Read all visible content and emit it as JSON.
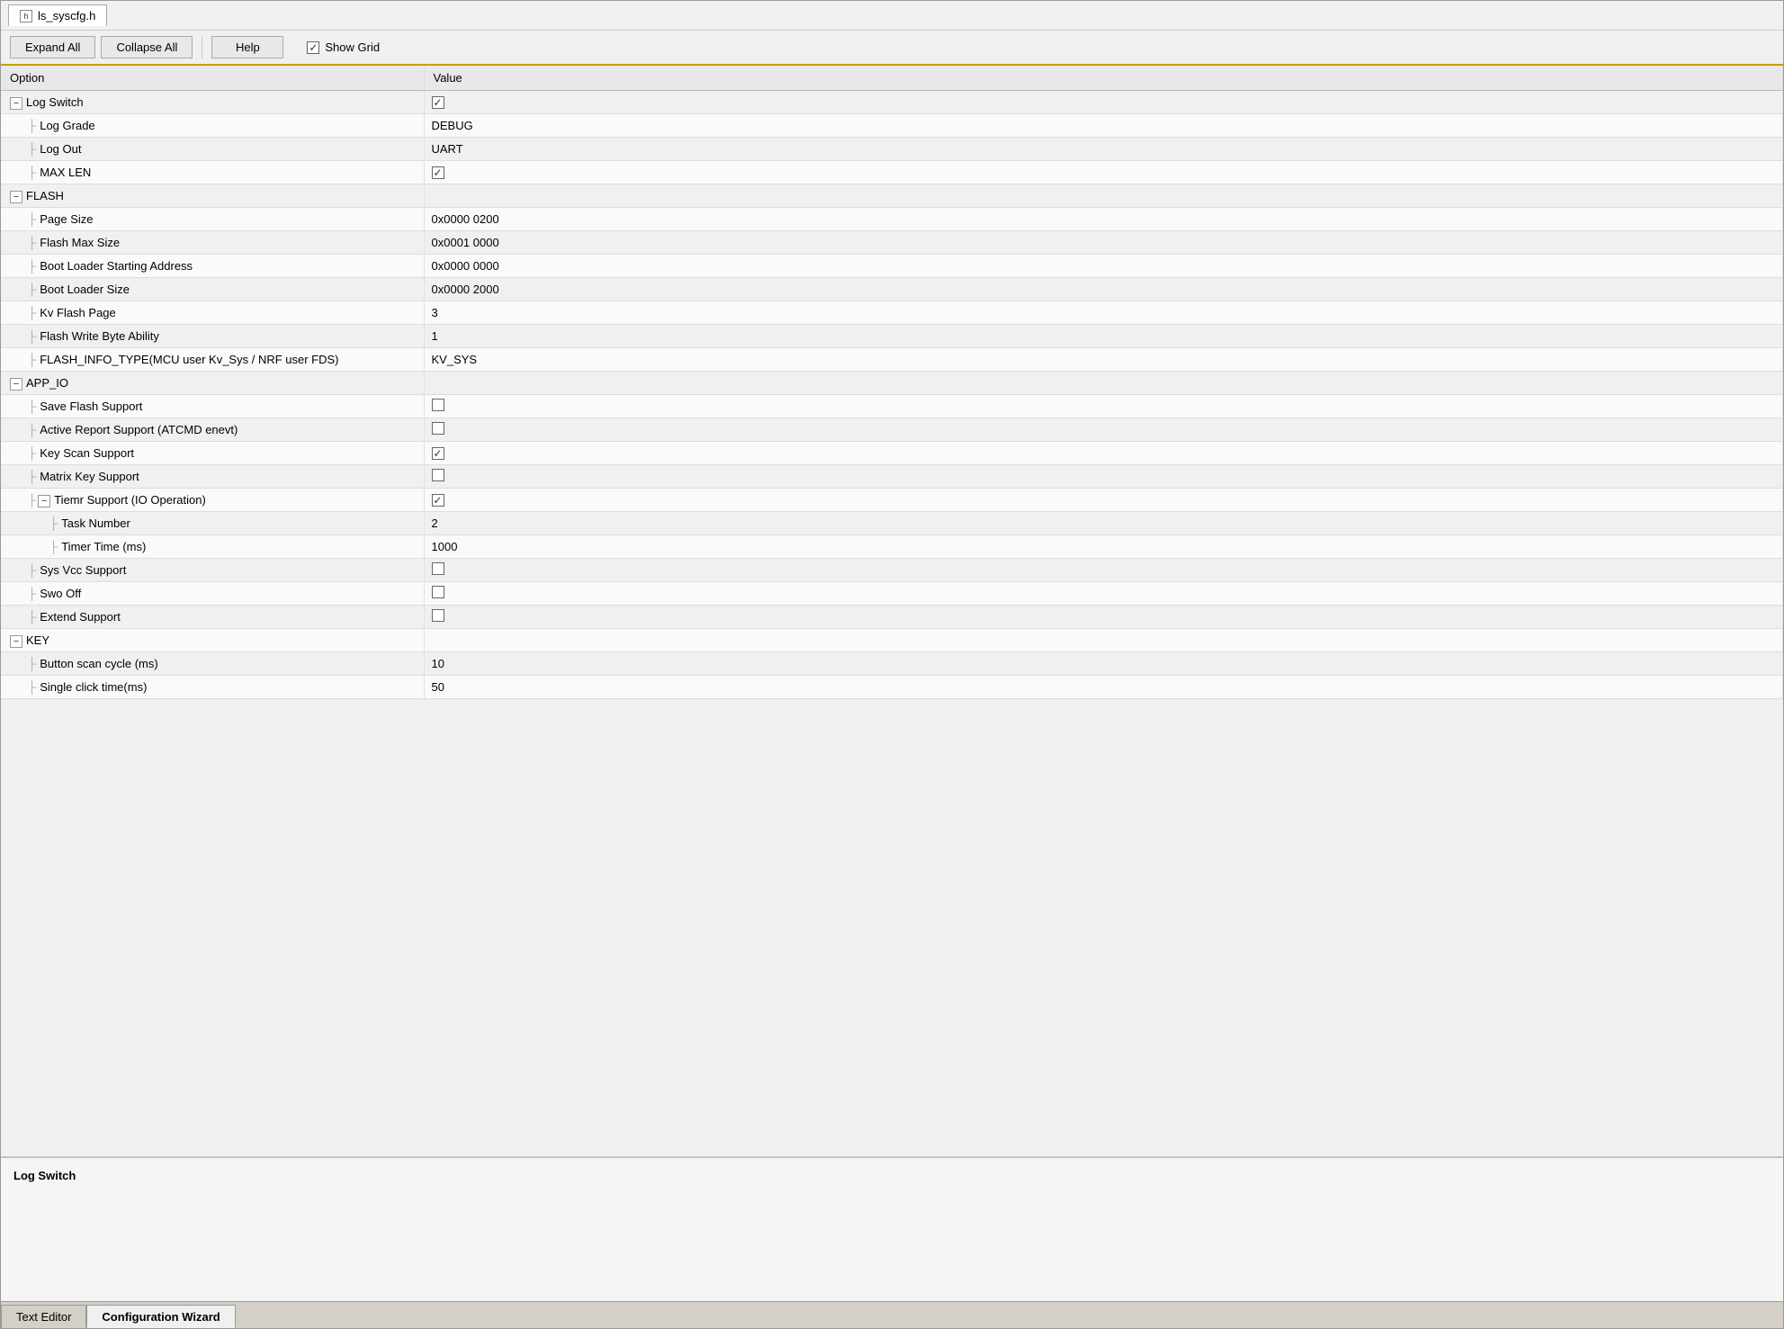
{
  "titleTab": {
    "icon": "h",
    "label": "ls_syscfg.h"
  },
  "toolbar": {
    "expandAll": "Expand All",
    "collapseAll": "Collapse All",
    "help": "Help",
    "showGrid": "Show Grid",
    "showGridChecked": true
  },
  "grid": {
    "headers": [
      "Option",
      "Value"
    ],
    "rows": [
      {
        "id": "log-switch",
        "type": "group",
        "indent": 0,
        "expanded": true,
        "label": "Log Switch",
        "value": "checked",
        "valueType": "checkbox"
      },
      {
        "id": "log-grade",
        "type": "leaf",
        "indent": 1,
        "label": "Log Grade",
        "value": "DEBUG",
        "valueType": "text"
      },
      {
        "id": "log-out",
        "type": "leaf",
        "indent": 1,
        "label": "Log Out",
        "value": "UART",
        "valueType": "text"
      },
      {
        "id": "max-len",
        "type": "leaf",
        "indent": 1,
        "label": "MAX LEN",
        "value": "checked",
        "valueType": "checkbox"
      },
      {
        "id": "flash",
        "type": "group",
        "indent": 0,
        "expanded": true,
        "label": "FLASH",
        "value": "",
        "valueType": "empty"
      },
      {
        "id": "page-size",
        "type": "leaf",
        "indent": 1,
        "label": "Page Size",
        "value": "0x0000 0200",
        "valueType": "text"
      },
      {
        "id": "flash-max-size",
        "type": "leaf",
        "indent": 1,
        "label": "Flash Max Size",
        "value": "0x0001 0000",
        "valueType": "text"
      },
      {
        "id": "boot-loader-addr",
        "type": "leaf",
        "indent": 1,
        "label": "Boot Loader Starting Address",
        "value": "0x0000 0000",
        "valueType": "text"
      },
      {
        "id": "boot-loader-size",
        "type": "leaf",
        "indent": 1,
        "label": "Boot Loader Size",
        "value": "0x0000 2000",
        "valueType": "text"
      },
      {
        "id": "kv-flash-page",
        "type": "leaf",
        "indent": 1,
        "label": "Kv Flash Page",
        "value": "3",
        "valueType": "text"
      },
      {
        "id": "flash-write-byte",
        "type": "leaf",
        "indent": 1,
        "label": "Flash Write Byte Ability",
        "value": "1",
        "valueType": "text"
      },
      {
        "id": "flash-info-type",
        "type": "leaf",
        "indent": 1,
        "label": "FLASH_INFO_TYPE(MCU user Kv_Sys / NRF user FDS)",
        "value": "KV_SYS",
        "valueType": "text"
      },
      {
        "id": "app-io",
        "type": "group",
        "indent": 0,
        "expanded": true,
        "label": "APP_IO",
        "value": "",
        "valueType": "empty"
      },
      {
        "id": "save-flash",
        "type": "leaf",
        "indent": 1,
        "label": "Save Flash Support",
        "value": "unchecked",
        "valueType": "checkbox"
      },
      {
        "id": "active-report",
        "type": "leaf",
        "indent": 1,
        "label": "Active Report Support (ATCMD enevt)",
        "value": "unchecked",
        "valueType": "checkbox"
      },
      {
        "id": "key-scan",
        "type": "leaf",
        "indent": 1,
        "label": "Key Scan Support",
        "value": "checked",
        "valueType": "checkbox"
      },
      {
        "id": "matrix-key",
        "type": "leaf",
        "indent": 1,
        "label": "Matrix Key Support",
        "value": "unchecked",
        "valueType": "checkbox"
      },
      {
        "id": "tiemr-support",
        "type": "group",
        "indent": 1,
        "expanded": true,
        "label": "Tiemr Support (IO Operation)",
        "value": "checked",
        "valueType": "checkbox"
      },
      {
        "id": "task-number",
        "type": "leaf",
        "indent": 2,
        "label": "Task Number",
        "value": "2",
        "valueType": "text"
      },
      {
        "id": "timer-time",
        "type": "leaf",
        "indent": 2,
        "label": "Timer Time (ms)",
        "value": "1000",
        "valueType": "text"
      },
      {
        "id": "sys-vcc",
        "type": "leaf",
        "indent": 1,
        "label": "Sys Vcc Support",
        "value": "unchecked",
        "valueType": "checkbox"
      },
      {
        "id": "swo-off",
        "type": "leaf",
        "indent": 1,
        "label": "Swo Off",
        "value": "unchecked",
        "valueType": "checkbox"
      },
      {
        "id": "extend-support",
        "type": "leaf",
        "indent": 1,
        "label": "Extend Support",
        "value": "unchecked",
        "valueType": "checkbox"
      },
      {
        "id": "key",
        "type": "group",
        "indent": 0,
        "expanded": true,
        "label": "KEY",
        "value": "",
        "valueType": "empty"
      },
      {
        "id": "button-scan",
        "type": "leaf",
        "indent": 1,
        "label": "Button scan cycle (ms)",
        "value": "10",
        "valueType": "text"
      },
      {
        "id": "single-click",
        "type": "leaf",
        "indent": 1,
        "label": "Single click time(ms)",
        "value": "50",
        "valueType": "text"
      }
    ]
  },
  "descriptionPanel": {
    "text": "Log Switch"
  },
  "bottomTabs": [
    {
      "id": "text-editor",
      "label": "Text Editor",
      "active": false
    },
    {
      "id": "config-wizard",
      "label": "Configuration Wizard",
      "active": true
    }
  ]
}
